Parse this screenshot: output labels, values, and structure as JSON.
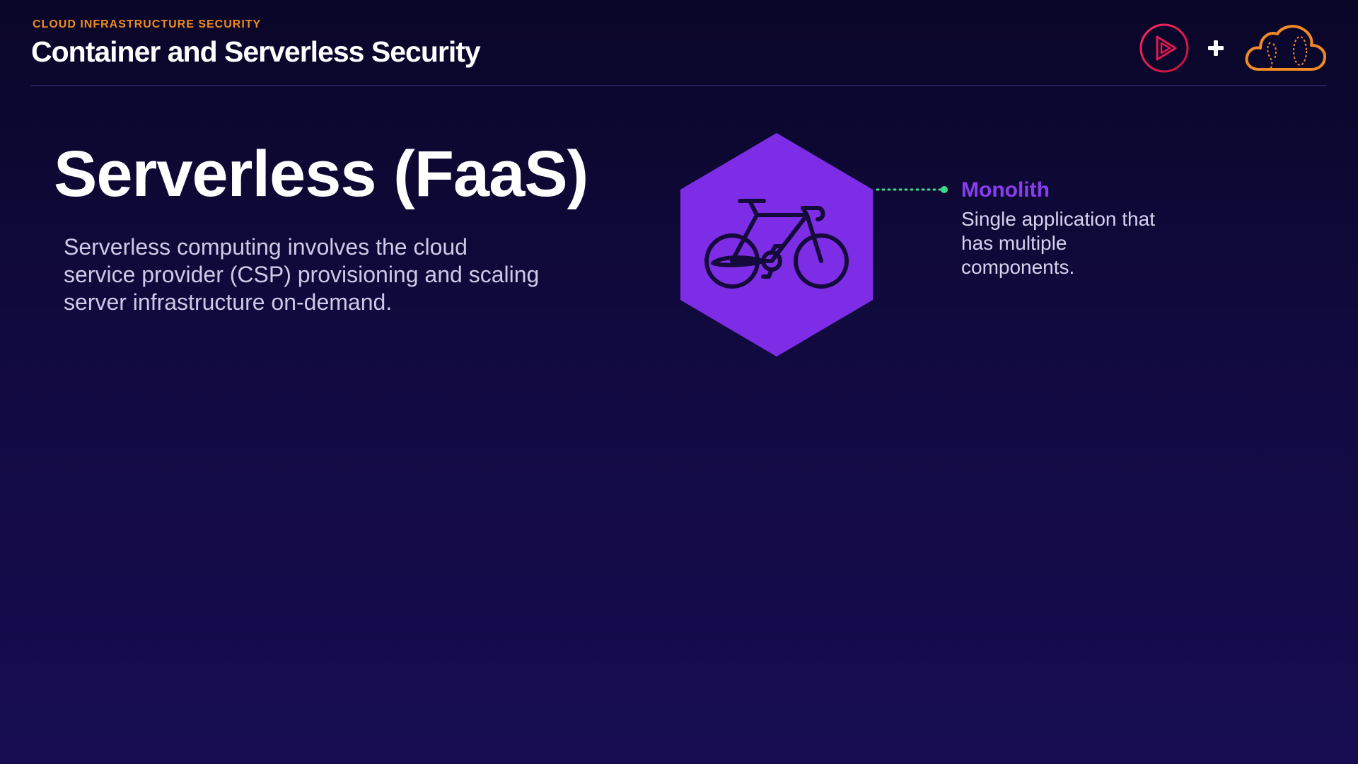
{
  "header": {
    "eyebrow": "CLOUD INFRASTRUCTURE SECURITY",
    "course_title": "Container and Serverless Security",
    "logos": [
      "pluralsight-play-logo",
      "plus-icon",
      "cloud-logo"
    ]
  },
  "slide": {
    "title": "Serverless (FaaS)",
    "body": "Serverless computing involves the cloud service provider (CSP) provisioning and scaling server infrastructure on-demand.",
    "illustration_icon": "bicycle-icon",
    "callout": {
      "title": "Monolith",
      "body": "Single application that has multiple components."
    }
  },
  "colors": {
    "background_top": "#0a0628",
    "background_bottom": "#170c52",
    "eyebrow_orange": "#f08a24",
    "hexagon_purple": "#7e2de6",
    "callout_title_purple": "#8a3df0",
    "connector_green": "#3ddc84",
    "logo_red": "#e0194f",
    "logo_orange": "#f08a24"
  }
}
